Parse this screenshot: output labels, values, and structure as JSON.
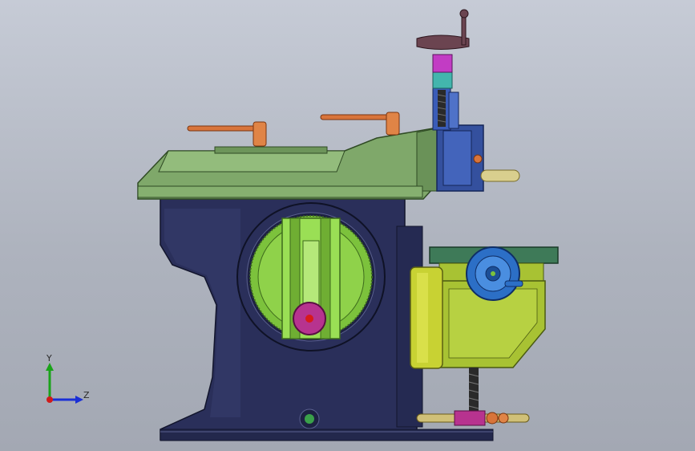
{
  "viewport": {
    "background_top": "#c6cbd6",
    "background_bottom": "#a3a8b3"
  },
  "triad": {
    "y_label": "Y",
    "z_label": "Z",
    "y_color": "#1aa31a",
    "z_color": "#1a2fd6",
    "x_color": "#d01a1a"
  },
  "colors": {
    "base": "#2a2f5a",
    "ram": "#7fa86a",
    "handle": "#d8743a",
    "gear": "#7cc23c",
    "table": "#a8c233",
    "handwheel": "#2c6fc6",
    "crank": "#6b4450"
  }
}
